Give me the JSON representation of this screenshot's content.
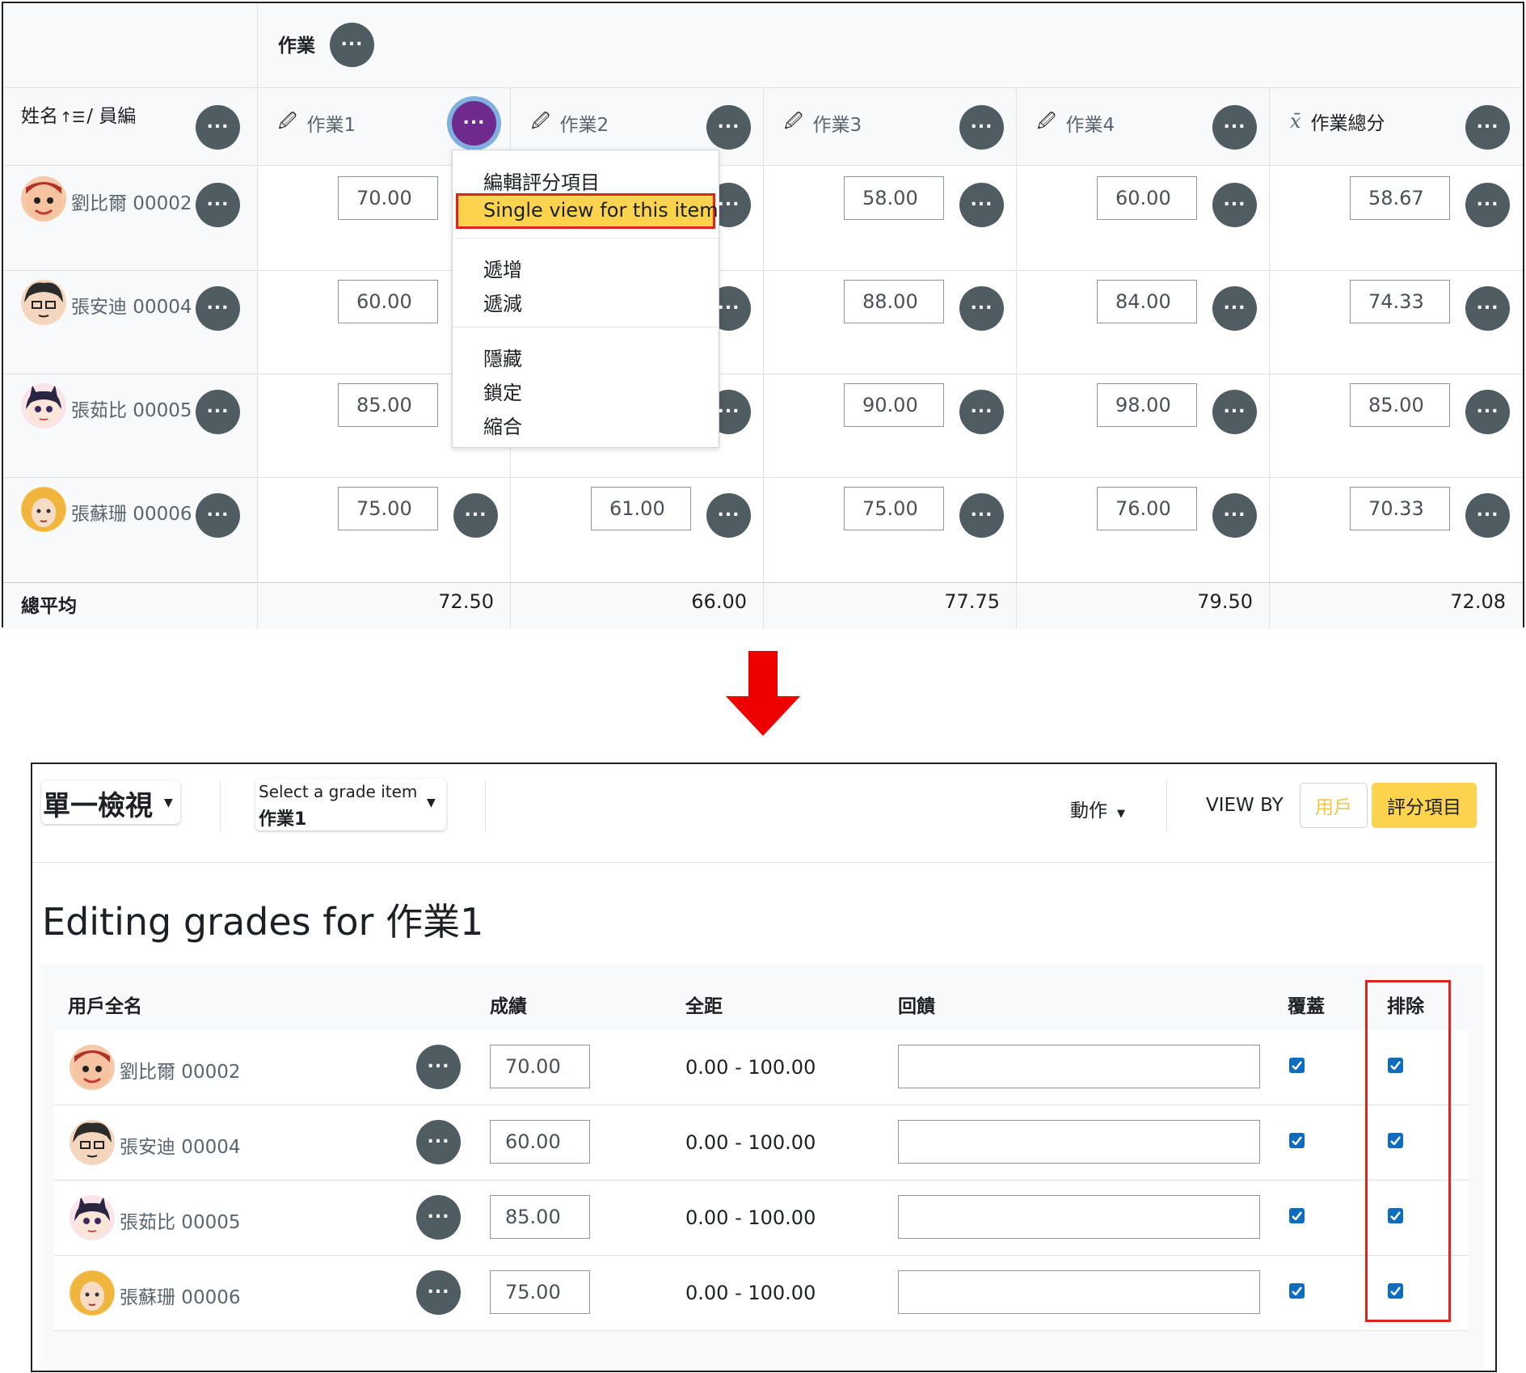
{
  "top_grader": {
    "category_header": "作業",
    "name_header": "姓名",
    "name_header_suffix": "/ 員編",
    "columns": [
      "作業1",
      "作業2",
      "作業3",
      "作業4",
      "作業總分"
    ],
    "rows": [
      {
        "name": "劉比爾 00002",
        "grades": [
          "70.00",
          "",
          "58.00",
          "60.00",
          "58.67"
        ]
      },
      {
        "name": "張安迪 00004",
        "grades": [
          "60.00",
          "",
          "88.00",
          "84.00",
          "74.33"
        ]
      },
      {
        "name": "張茹比 00005",
        "grades": [
          "85.00",
          "",
          "90.00",
          "98.00",
          "85.00"
        ]
      },
      {
        "name": "張蘇珊 00006",
        "grades": [
          "75.00",
          "61.00",
          "75.00",
          "76.00",
          "70.33"
        ]
      }
    ],
    "overall_label": "總平均",
    "averages": [
      "72.50",
      "66.00",
      "77.75",
      "79.50",
      "72.08"
    ],
    "menu_items": [
      "編輯評分項目",
      "Single view for this item",
      "遞增",
      "遞減",
      "隱藏",
      "鎖定",
      "縮合"
    ]
  },
  "single_view": {
    "mode_label": "單一檢視",
    "grade_item_select_label": "Select a grade item",
    "grade_item_selected": "作業1",
    "actions_label": "動作",
    "view_by_label": "VIEW BY",
    "view_by_user": "用戶",
    "view_by_item": "評分項目",
    "page_title": "Editing grades for 作業1",
    "headers": {
      "fullname": "用戶全名",
      "grade": "成績",
      "range": "全距",
      "feedback": "回饋",
      "override": "覆蓋",
      "exclude": "排除"
    },
    "rows": [
      {
        "name": "劉比爾 00002",
        "grade": "70.00",
        "range": "0.00 - 100.00",
        "feedback": "",
        "override": true,
        "exclude": true
      },
      {
        "name": "張安迪 00004",
        "grade": "60.00",
        "range": "0.00 - 100.00",
        "feedback": "",
        "override": true,
        "exclude": true
      },
      {
        "name": "張茹比 00005",
        "grade": "85.00",
        "range": "0.00 - 100.00",
        "feedback": "",
        "override": true,
        "exclude": true
      },
      {
        "name": "張蘇珊 00006",
        "grade": "75.00",
        "range": "0.00 - 100.00",
        "feedback": "",
        "override": true,
        "exclude": true
      }
    ]
  },
  "colors": {
    "menu_button_active": "#6f2a8e",
    "menu_button": "#4f5c62",
    "highlight_fill": "#fcd34d",
    "highlight_border": "#e0241d",
    "arrow": "#ee0000",
    "checkbox": "#0f6cbf",
    "view_by_active": "#fcd34d"
  }
}
